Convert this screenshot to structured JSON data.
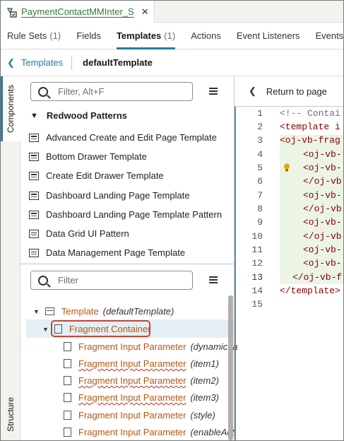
{
  "file_tab": {
    "name": "PaymentContactMMInter_S",
    "close": "✕"
  },
  "subtabs": [
    {
      "label": "Rule Sets",
      "count": "(1)"
    },
    {
      "label": "Fields",
      "count": ""
    },
    {
      "label": "Templates",
      "count": "(1)"
    },
    {
      "label": "Actions",
      "count": ""
    },
    {
      "label": "Event Listeners",
      "count": ""
    },
    {
      "label": "Events",
      "count": ""
    }
  ],
  "breadcrumb": {
    "parent": "Templates",
    "current": "defaultTemplate"
  },
  "rail": {
    "top": "Components",
    "bottom": "Structure"
  },
  "components": {
    "search_placeholder": "Filter, Alt+F",
    "group": "Redwood Patterns",
    "items": [
      "Advanced Create and Edit Page Template",
      "Bottom Drawer Template",
      "Create Edit Drawer Template",
      "Dashboard Landing Page Template",
      "Dashboard Landing Page Template Pattern",
      "Data Grid UI Pattern",
      "Data Management Page Template"
    ]
  },
  "structure": {
    "search_placeholder": "Filter",
    "root": {
      "label": "Template",
      "detail": "(defaultTemplate)"
    },
    "container": {
      "label": "Fragment Container"
    },
    "params": [
      {
        "label": "Fragment Input Parameter",
        "detail": "(dynamicLa"
      },
      {
        "label": "Fragment Input Parameter",
        "detail": "(item1)"
      },
      {
        "label": "Fragment Input Parameter",
        "detail": "(item2)"
      },
      {
        "label": "Fragment Input Parameter",
        "detail": "(item3)"
      },
      {
        "label": "Fragment Input Parameter",
        "detail": "(style)"
      },
      {
        "label": "Fragment Input Parameter",
        "detail": "(enableAct"
      }
    ]
  },
  "editor": {
    "return_label": "Return to page",
    "line_numbers": [
      "1",
      "2",
      "3",
      "4",
      "5",
      "6",
      "7",
      "8",
      "9",
      "10",
      "11",
      "12",
      "13",
      "14",
      "15"
    ],
    "active_line": "13",
    "lines": [
      "<!-- Contai",
      "<template i",
      "<oj-vb-frag",
      "<oj-vb-",
      "<oj-vb-",
      "</oj-vb",
      "<oj-vb-",
      "</oj-vb",
      "<oj-vb-",
      "</oj-vb",
      "<oj-vb-",
      "<oj-vb-",
      "</oj-vb-f",
      "</template>",
      ""
    ]
  }
}
